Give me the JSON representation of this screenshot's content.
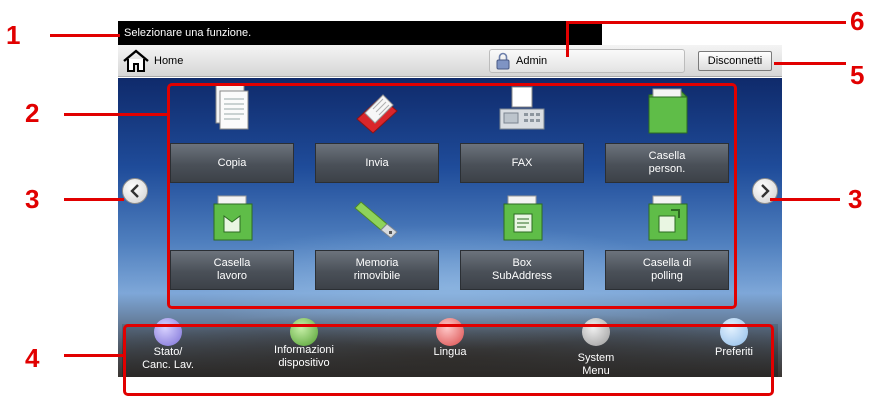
{
  "status_bar": {
    "message": "Selezionare una funzione."
  },
  "header": {
    "home_label": "Home",
    "user_label": "Admin",
    "logout_label": "Disconnetti"
  },
  "functions": [
    {
      "label": "Copia",
      "icon": "copy-icon"
    },
    {
      "label": "Invia",
      "icon": "send-icon"
    },
    {
      "label": "FAX",
      "icon": "fax-icon"
    },
    {
      "label": "Casella\nperson.",
      "icon": "custom-box-icon"
    },
    {
      "label": "Casella\nlavoro",
      "icon": "job-box-icon"
    },
    {
      "label": "Memoria\nrimovibile",
      "icon": "usb-memory-icon"
    },
    {
      "label": "Box\nSubAddress",
      "icon": "subaddress-box-icon"
    },
    {
      "label": "Casella di\npolling",
      "icon": "polling-box-icon"
    }
  ],
  "task_bar": [
    {
      "label": "Stato/\nCanc. Lav.",
      "icon": "status-icon"
    },
    {
      "label": "Informazioni\ndispositivo",
      "icon": "device-info-icon"
    },
    {
      "label": "Lingua",
      "icon": "language-icon"
    },
    {
      "label": "System\nMenu",
      "icon": "system-menu-icon"
    },
    {
      "label": "Preferiti",
      "icon": "favorites-icon"
    }
  ],
  "callouts": [
    "1",
    "2",
    "3",
    "3",
    "4",
    "5",
    "6"
  ],
  "colors": {
    "callout": "#e10000",
    "status_bar": "#000000",
    "function_button": "#4a5058"
  }
}
